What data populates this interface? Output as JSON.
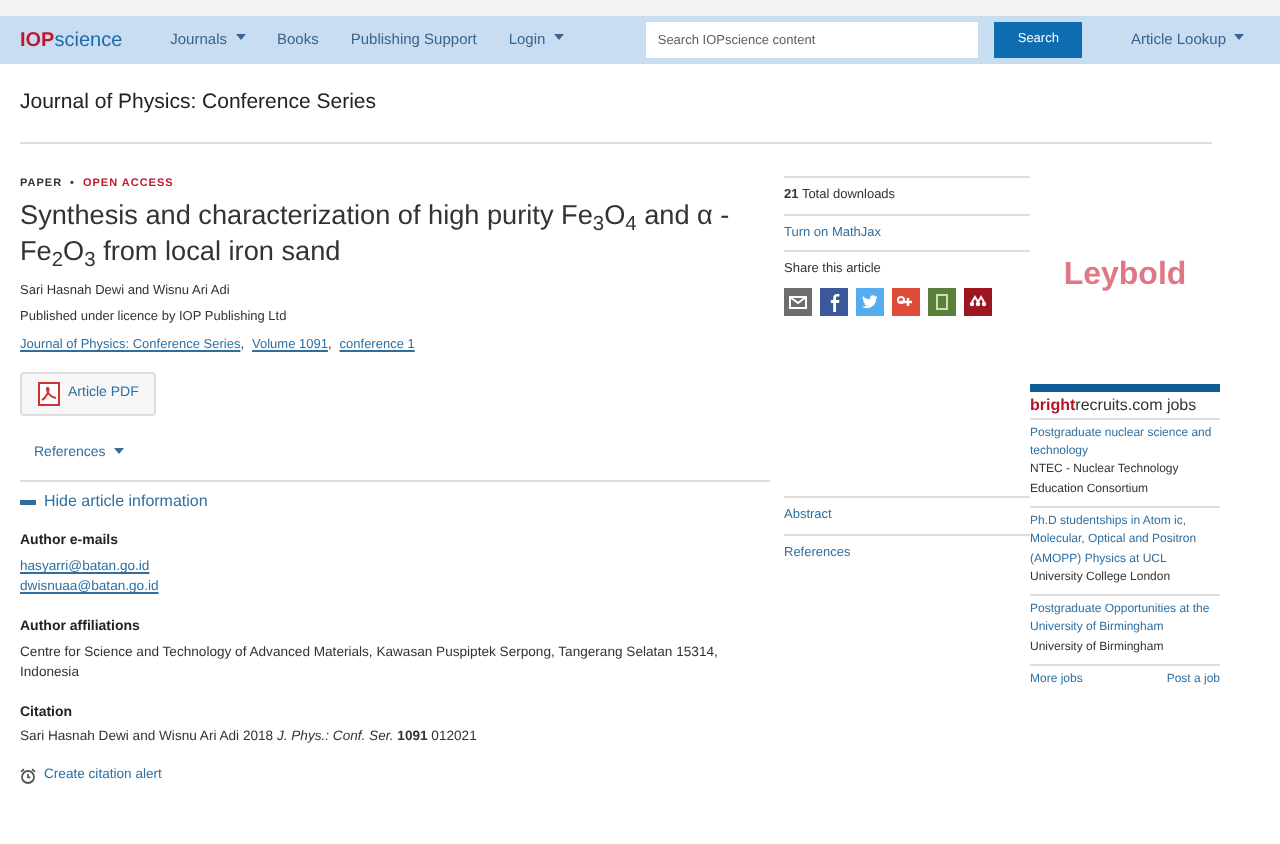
{
  "navbar": {
    "logo_red": "IOP",
    "logo_blue": "science",
    "menu": [
      {
        "label": "Journals",
        "dropdown": true
      },
      {
        "label": "Books",
        "dropdown": false
      },
      {
        "label": "Publishing Support",
        "dropdown": false
      },
      {
        "label": "Login",
        "dropdown": true
      }
    ],
    "search": {
      "placeholder": "Search IOPscience content",
      "button": "Search"
    },
    "article_lookup": {
      "label": "Article Lookup",
      "dropdown": true
    }
  },
  "journal_title": "Journal of Physics: Conference Series",
  "article": {
    "type": "PAPER",
    "separator": "•",
    "access": "OPEN ACCESS",
    "title": "Synthesis and characterization of high purity Fe$_{3}$O$_{4}$ and α - Fe$_{2}$O$_{3}$ from local iron sand",
    "authors": "Sari Hasnah Dewi and Wisnu Ari Adi",
    "licence": "Published under licence by IOP Publishing Ltd",
    "source_links": [
      {
        "text": "Journal of Physics: Conference Series",
        "suffix": ","
      },
      {
        "text": "Volume 1091",
        "suffix": ","
      },
      {
        "text": "conference 1"
      }
    ],
    "pdf_button": "Article PDF",
    "references_toggle": "References",
    "info_toggle": {
      "label": "Hide article information",
      "expanded": true
    },
    "sections": [
      {
        "heading": "Author e-mails",
        "kind": "links",
        "lines": [
          "hasyarri@batan.go.id",
          "dwisnuaa@batan.go.id"
        ]
      },
      {
        "heading": "Author affiliations",
        "kind": "text",
        "lines": [
          "Centre for Science and Technology of Advanced Materials, Kawasan Puspiptek Serpong, Tangerang Selatan 15314, Indonesia"
        ]
      },
      {
        "heading": "Citation",
        "kind": "text",
        "lines": [
          "Sari Hasnah Dewi and Wisnu Ari Adi 2018 *J. Phys.: Conf. Ser.* **1091** 012021"
        ]
      }
    ],
    "citation_alert": "Create citation alert"
  },
  "sidebar": {
    "downloads_count": "21",
    "downloads_label": "Total downloads",
    "mathjax_link": "Turn on MathJax",
    "share_label": "Share this article",
    "share_buttons": [
      {
        "kind": "email",
        "color": "#6d6d6d"
      },
      {
        "kind": "facebook",
        "color": "#3b5998"
      },
      {
        "kind": "twitter",
        "color": "#55acee"
      },
      {
        "kind": "googleplus",
        "color": "#dd4b39"
      },
      {
        "kind": "bookmark",
        "color": "#5a7f3a"
      },
      {
        "kind": "mendeley",
        "color": "#9d1620"
      }
    ],
    "nav_links": [
      "Abstract",
      "References"
    ]
  },
  "ad": {
    "brand": "Leybold"
  },
  "jobs": {
    "brand_bold": "bright",
    "brand_rest": "recruits.com jobs",
    "items": [
      {
        "title": "Postgraduate nuclear science and technology",
        "employer": "NTEC - Nuclear Technology Education Consortium"
      },
      {
        "title": "Ph.D studentships in Atom ic, Molecular, Optical and Positron (AMOPP) Physics at UCL",
        "employer": "University College London"
      },
      {
        "title": "Postgraduate Opportunities at the University of Birmingham",
        "employer": "University of Birmingham"
      }
    ],
    "more_link": "More jobs",
    "post_link": "Post a job"
  }
}
